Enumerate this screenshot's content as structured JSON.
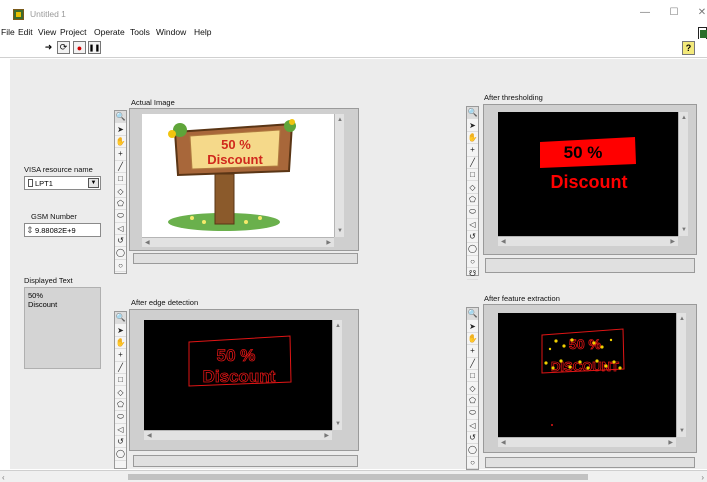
{
  "window": {
    "title": "Untitled 1"
  },
  "menu": [
    "File",
    "Edit",
    "View",
    "Project",
    "Operate",
    "Tools",
    "Window",
    "Help"
  ],
  "toolbar": {
    "run_glyph": "➜",
    "run_continuous_glyph": "⟳",
    "abort_glyph": "●",
    "pause_glyph": "❚❚",
    "help_glyph": "?"
  },
  "controls": {
    "visa": {
      "label": "VISA resource name",
      "value": "LPT1",
      "dropdown_glyph": "▼"
    },
    "gsm": {
      "label": "GSM Number",
      "value": "9.88082E+9",
      "spin_glyph": "⇕"
    },
    "displayed_text": {
      "label": "Displayed Text",
      "lines": [
        "50%",
        "Discount"
      ]
    }
  },
  "displays": {
    "actual": {
      "label": "Actual Image",
      "sign_line1": "50 %",
      "sign_line2": "Discount"
    },
    "threshold": {
      "label": "After thresholding",
      "line1": "50 %",
      "line2": "Discount"
    },
    "edge": {
      "label": "After edge detection",
      "line1": "50 %",
      "line2": "Discount"
    },
    "feature": {
      "label": "After feature extraction",
      "line1": "50 %",
      "line2": "DISCOUNT"
    }
  },
  "palette_tools": [
    "🔍",
    "➤",
    "✋",
    "+",
    "╱",
    "□",
    "◇",
    "⬠",
    "⬭",
    "◁",
    "↺",
    "◯",
    "○",
    "☋"
  ],
  "colors": {
    "panel": "#ececec",
    "threshold_red": "#ff0000",
    "edge_red": "#e01515",
    "feature_yellow": "#f0d000"
  }
}
